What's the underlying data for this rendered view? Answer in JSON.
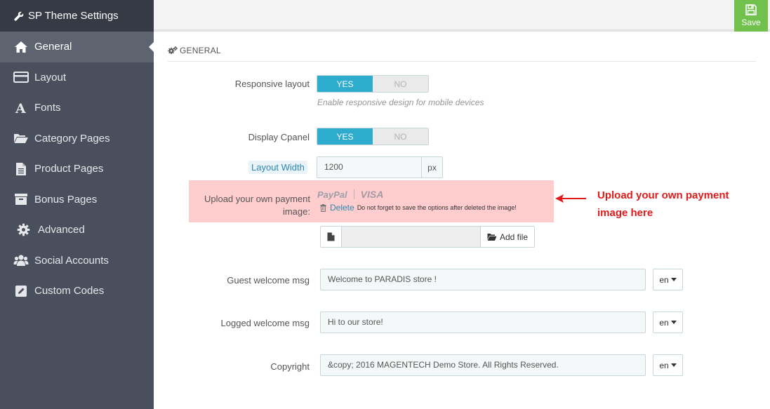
{
  "app": {
    "title": "SP Theme Settings"
  },
  "toolbar": {
    "save_label": "Save"
  },
  "sidebar": {
    "items": [
      {
        "label": "General",
        "icon": "home-icon",
        "active": true
      },
      {
        "label": "Layout",
        "icon": "layout-icon"
      },
      {
        "label": "Fonts",
        "icon": "font-icon"
      },
      {
        "label": "Category Pages",
        "icon": "folder-open-icon"
      },
      {
        "label": "Product Pages",
        "icon": "file-icon"
      },
      {
        "label": "Bonus Pages",
        "icon": "archive-icon"
      },
      {
        "label": "Advanced",
        "icon": "gear-icon"
      },
      {
        "label": "Social Accounts",
        "icon": "users-icon"
      },
      {
        "label": "Custom Codes",
        "icon": "edit-icon"
      }
    ]
  },
  "section": {
    "title": "GENERAL"
  },
  "fields": {
    "responsive": {
      "label": "Responsive layout",
      "yes": "YES",
      "no": "NO",
      "value": "YES",
      "help": "Enable responsive design for mobile devices"
    },
    "cpanel": {
      "label": "Display Cpanel",
      "yes": "YES",
      "no": "NO",
      "value": "YES"
    },
    "layout_width": {
      "label": "Layout Width",
      "value": "1200",
      "unit": "px"
    },
    "payment": {
      "label": "Upload your own payment image:",
      "logo_paypal": "PayPal",
      "logo_visa": "VISA",
      "delete_label": "Delete",
      "delete_note": "Do not forget to save the options after deleted the image!",
      "add_file_label": "Add file"
    },
    "guest_welcome": {
      "label": "Guest welcome msg",
      "value": "Welcome to PARADIS store !",
      "lang": "en"
    },
    "logged_welcome": {
      "label": "Logged welcome msg",
      "value": "Hi to our store!",
      "lang": "en"
    },
    "copyright": {
      "label": "Copyright",
      "value": "&copy; 2016 MAGENTECH Demo Store. All Rights Reserved.",
      "lang": "en"
    }
  },
  "annotation": {
    "text": "Upload your own payment image here",
    "color": "#e21a1a"
  },
  "colors": {
    "sidebar_bg": "#4a4f5d",
    "sidebar_header_bg": "#363a45",
    "active_bg": "#5e6370",
    "toggle_on": "#2eacce",
    "save_green": "#72c14f",
    "highlight": "#ffcdcd"
  }
}
